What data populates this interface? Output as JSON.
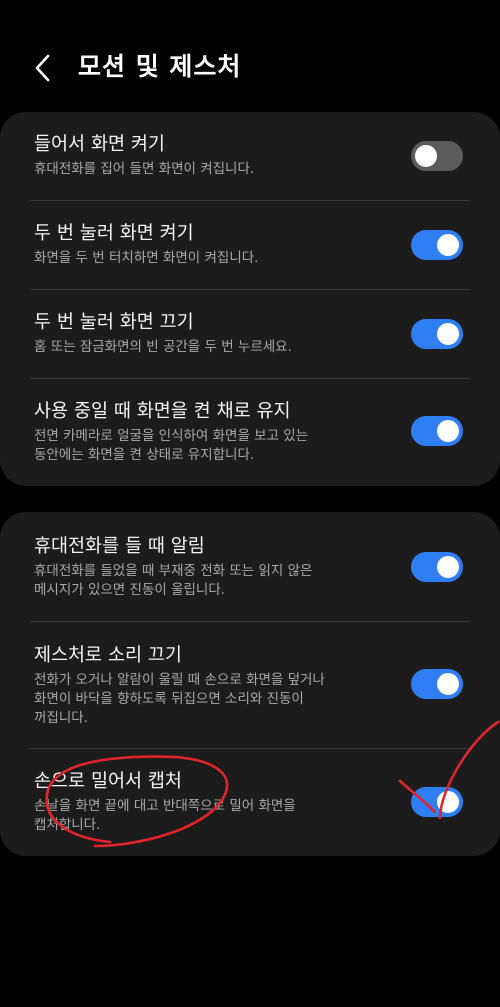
{
  "header": {
    "title": "모션 및 제스처"
  },
  "group1": [
    {
      "title": "들어서 화면 켜기",
      "subtitle": "휴대전화를 집어 들면 화면이 켜집니다.",
      "enabled": false
    },
    {
      "title": "두 번 눌러 화면 켜기",
      "subtitle": "화면을 두 번 터치하면 화면이 켜집니다.",
      "enabled": true
    },
    {
      "title": "두 번 눌러 화면 끄기",
      "subtitle": "홈 또는 잠금화면의 빈 공간을 두 번 누르세요.",
      "enabled": true
    },
    {
      "title": "사용 중일 때 화면을 켠 채로 유지",
      "subtitle_lines": [
        "전면 카메라로 얼굴을 인식하여 화면을 보고 있는",
        "동안에는 화면을 켠 상태로 유지합니다."
      ],
      "enabled": true
    }
  ],
  "group2": [
    {
      "title": "휴대전화를 들 때 알림",
      "subtitle_lines": [
        "휴대전화를 들었을 때 부재중 전화 또는 읽지 않은",
        "메시지가 있으면 진동이 울립니다."
      ],
      "enabled": true
    },
    {
      "title": "제스처로 소리 끄기",
      "subtitle_lines": [
        "전화가 오거나 알람이 울릴 때 손으로 화면을 덮거나",
        "화면이 바닥을 향하도록 뒤집으면 소리와 진동이",
        "꺼집니다."
      ],
      "enabled": true
    },
    {
      "title": "손으로 밀어서 캡처",
      "subtitle_lines": [
        "손날을 화면 끝에 대고 반대쪽으로 밀어 화면을",
        "캡처합니다."
      ],
      "enabled": true
    }
  ],
  "colors": {
    "accent": "#2f7ef4",
    "annotation": "#e0262a",
    "card": "#1c1c1c"
  },
  "icons": {
    "back": "chevron-left-icon"
  }
}
